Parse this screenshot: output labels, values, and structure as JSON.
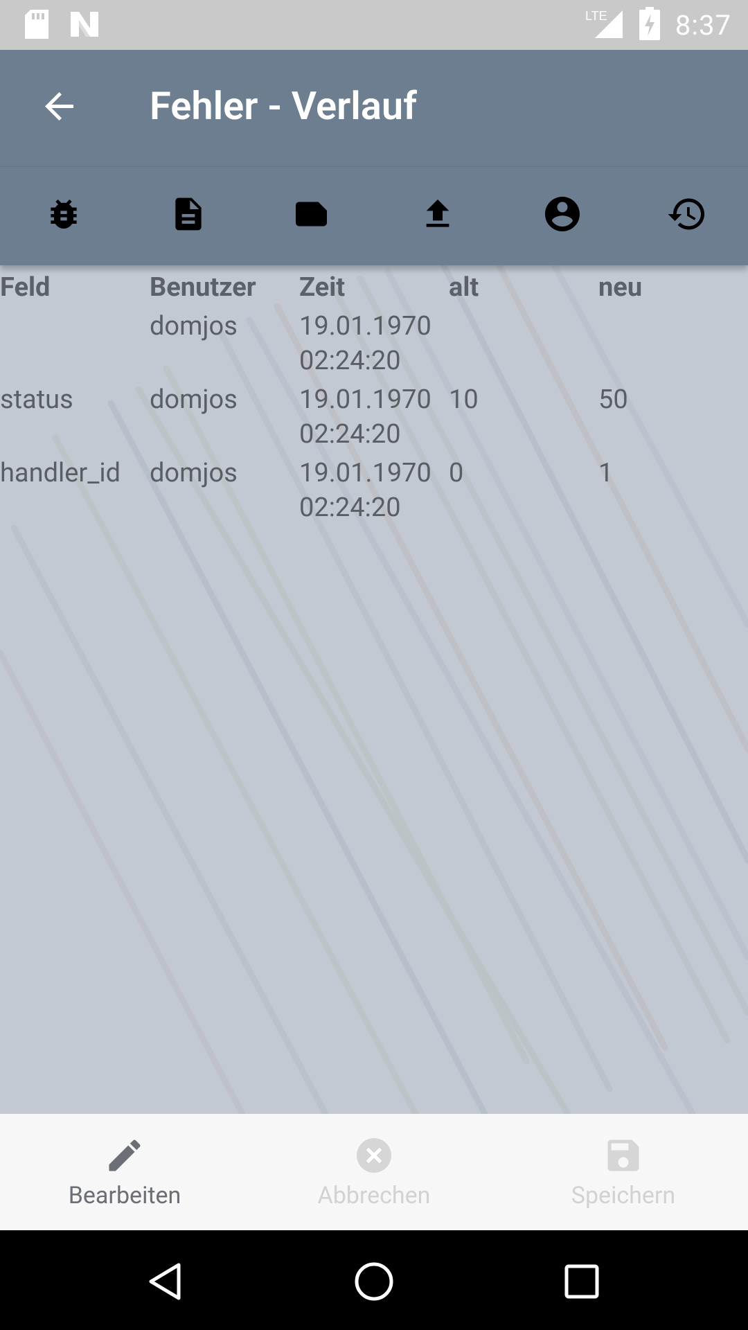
{
  "status_bar": {
    "time": "8:37",
    "network": "LTE",
    "icons": [
      "sd-card-icon",
      "n-logo-icon",
      "lte-signal-icon",
      "battery-charging-icon"
    ]
  },
  "app_bar": {
    "title": "Fehler - Verlauf",
    "back_icon": "arrow-back-icon"
  },
  "tabs": [
    {
      "icon": "bug-icon"
    },
    {
      "icon": "document-icon"
    },
    {
      "icon": "label-icon"
    },
    {
      "icon": "upload-icon"
    },
    {
      "icon": "account-circle-icon"
    },
    {
      "icon": "history-icon"
    }
  ],
  "table": {
    "headers": [
      "Feld",
      "Benutzer",
      "Zeit",
      "alt",
      "neu"
    ],
    "rows": [
      {
        "feld": "",
        "benutzer": "domjos",
        "zeit_date": "19.01.1970",
        "zeit_time": "02:24:20",
        "alt": "",
        "neu": ""
      },
      {
        "feld": "status",
        "benutzer": "domjos",
        "zeit_date": "19.01.1970",
        "zeit_time": "02:24:20",
        "alt": "10",
        "neu": "50"
      },
      {
        "feld": "handler_id",
        "benutzer": "domjos",
        "zeit_date": "19.01.1970",
        "zeit_time": "02:24:20",
        "alt": "0",
        "neu": "1"
      }
    ]
  },
  "bottom_nav": {
    "edit_label": "Bearbeiten",
    "cancel_label": "Abbrechen",
    "save_label": "Speichern"
  },
  "colors": {
    "app_bar": "#6d7e90",
    "content_bg": "#c3c9d2",
    "status_bar": "#c9c9c9"
  }
}
